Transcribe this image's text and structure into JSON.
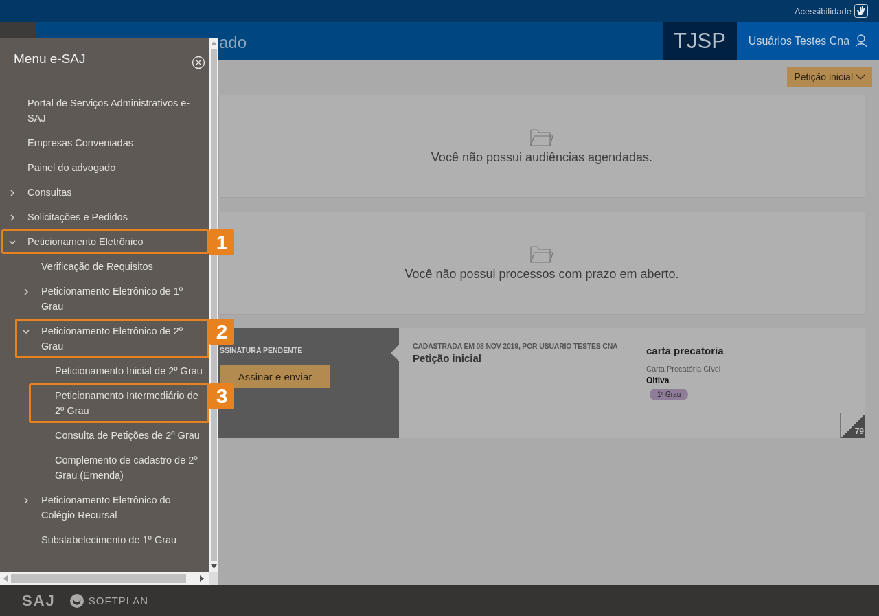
{
  "top_bar": {
    "accessibility_label": "Acessibilidade"
  },
  "header": {
    "title": "ado",
    "court": "TJSP",
    "user": "Usuários Testes Cna"
  },
  "toolbar": {
    "dropdown": "Petição inicial"
  },
  "empty_cards": [
    {
      "message": "Você não possui audiências agendadas."
    },
    {
      "message": "Você não possui processos com prazo em aberto."
    }
  ],
  "petition_card": {
    "status": "SSINATURA PENDENTE",
    "action": "Assinar e enviar",
    "meta": "CADASTRADA EM 08 NOV 2019, POR USUARIO TESTES CNA",
    "type": "Petição inicial",
    "title": "carta precatoria",
    "class": "Carta Precatória Cível",
    "subject": "Oitiva",
    "tag": "1º Grau",
    "count": "79"
  },
  "menu": {
    "title": "Menu e-SAJ",
    "items": [
      {
        "label": "Portal de Serviços Administrativos e-SAJ",
        "kind": "link"
      },
      {
        "label": "Empresas Conveniadas",
        "kind": "link"
      },
      {
        "label": "Painel do advogado",
        "kind": "link"
      },
      {
        "label": "Consultas",
        "kind": "folder",
        "expanded": false
      },
      {
        "label": "Solicitações e Pedidos",
        "kind": "folder",
        "expanded": false
      },
      {
        "label": "Peticionamento Eletrônico",
        "kind": "folder",
        "expanded": true,
        "callout": "1",
        "children": [
          {
            "label": "Verificação de Requisitos",
            "kind": "link"
          },
          {
            "label": "Peticionamento Eletrônico de 1º Grau",
            "kind": "folder",
            "expanded": false
          },
          {
            "label": "Peticionamento Eletrônico de 2º Grau",
            "kind": "folder",
            "expanded": true,
            "callout": "2",
            "children": [
              {
                "label": "Peticionamento Inicial de 2º Grau",
                "kind": "link"
              },
              {
                "label": "Peticionamento Intermediário de 2º Grau",
                "kind": "link",
                "callout": "3"
              },
              {
                "label": "Consulta de Petições de 2º Grau",
                "kind": "link"
              },
              {
                "label": "Complemento de cadastro de 2º Grau (Emenda)",
                "kind": "link"
              }
            ]
          },
          {
            "label": "Peticionamento Eletrônico do Colégio Recursal",
            "kind": "folder",
            "expanded": false
          },
          {
            "label": "Substabelecimento de 1º Grau",
            "kind": "link"
          }
        ]
      }
    ]
  },
  "footer": {
    "logos": [
      "SAJ",
      "SOFTPLAN"
    ]
  }
}
